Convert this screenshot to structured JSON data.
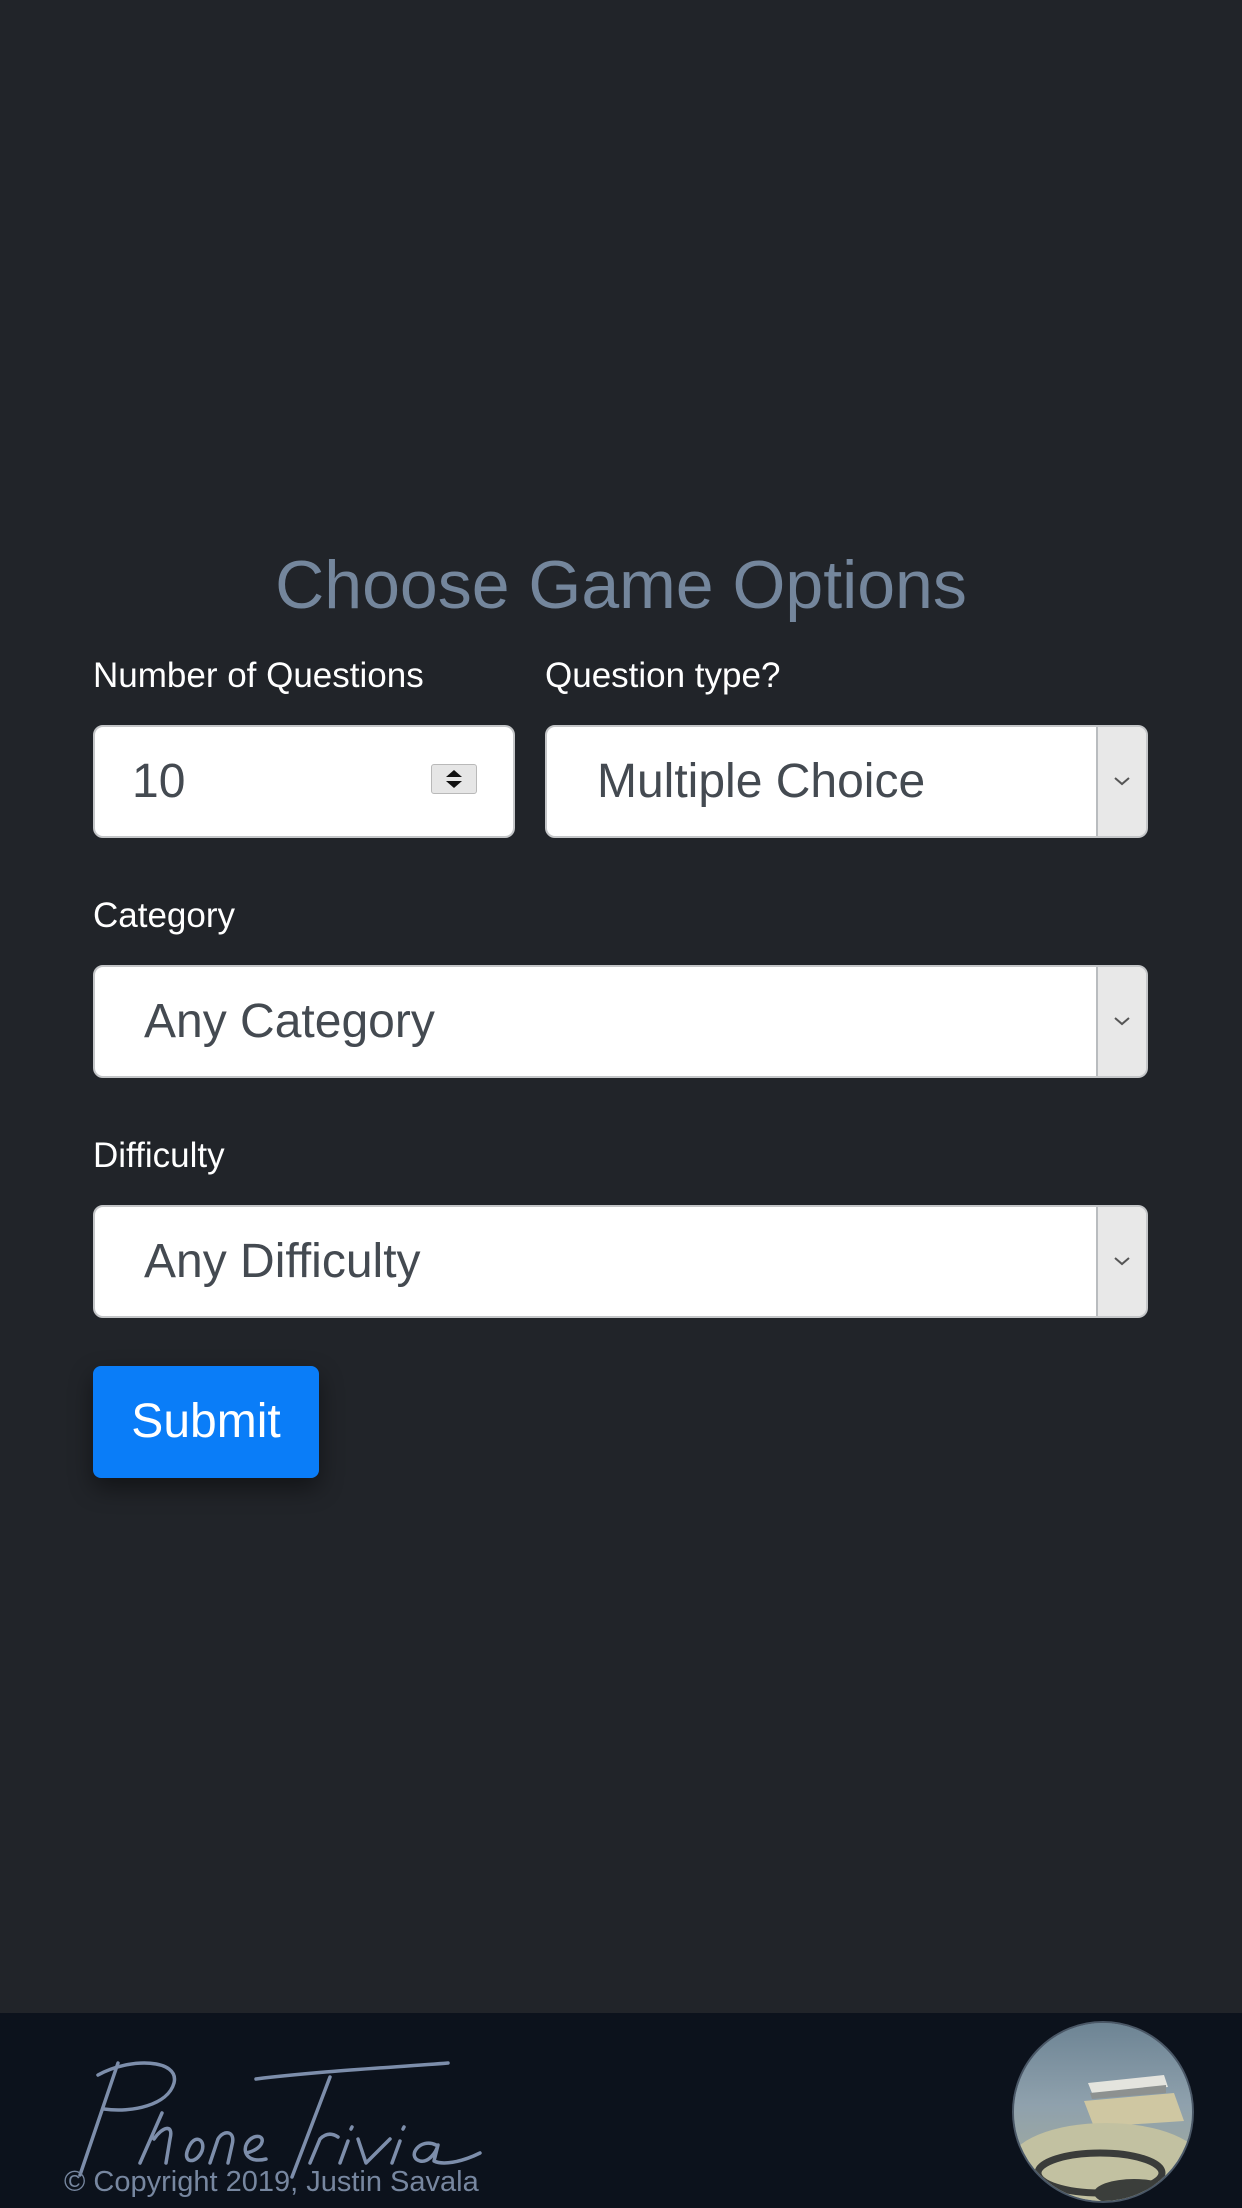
{
  "page": {
    "title": "Choose Game Options"
  },
  "form": {
    "num_questions": {
      "label": "Number of Questions",
      "value": "10"
    },
    "question_type": {
      "label": "Question type?",
      "value": "Multiple Choice"
    },
    "category": {
      "label": "Category",
      "value": "Any Category"
    },
    "difficulty": {
      "label": "Difficulty",
      "value": "Any Difficulty"
    },
    "submit_label": "Submit"
  },
  "footer": {
    "logo_text": "PhoneTrivia",
    "copyright": "© Copyright 2019, Justin Savala"
  },
  "colors": {
    "background": "#212429",
    "title": "#74869c",
    "accent": "#0a7df8",
    "footer_bg": "#0c121c"
  }
}
